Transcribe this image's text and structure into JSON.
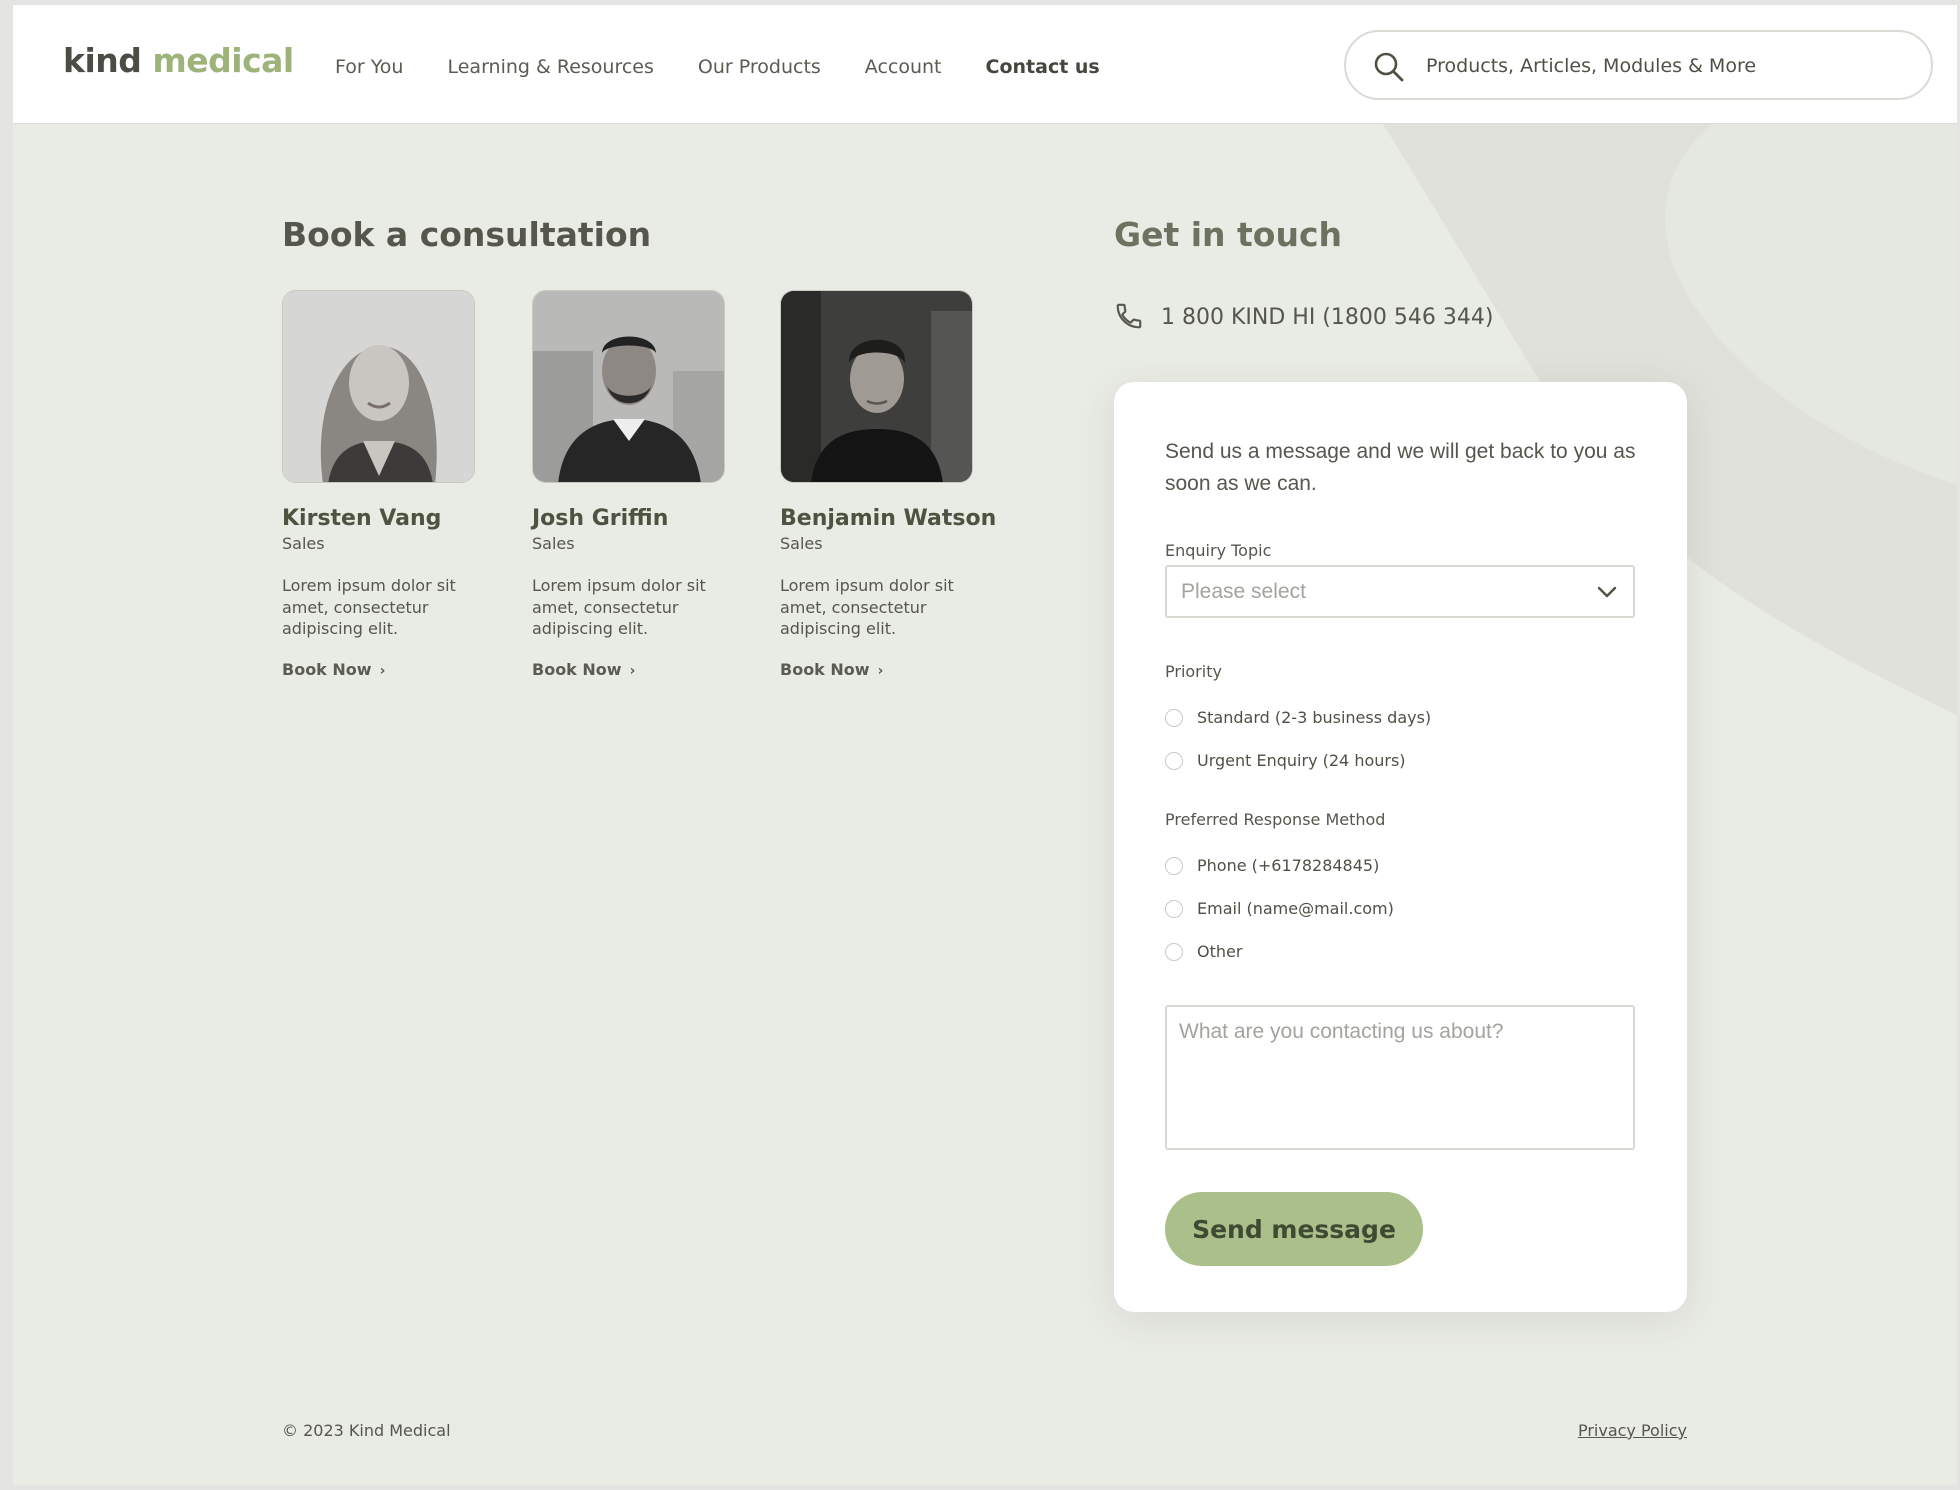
{
  "header": {
    "logo": {
      "part1": "kind",
      "part2": "medical"
    },
    "nav": [
      "For You",
      "Learning & Resources",
      "Our Products",
      "Account",
      "Contact us"
    ],
    "active_nav": "Contact us",
    "search": {
      "placeholder": "Products, Articles, Modules & More",
      "icon": "search-icon"
    }
  },
  "consultation": {
    "title": "Book a consultation",
    "people": [
      {
        "name": "Kirsten Vang",
        "role": "Sales",
        "description": "Lorem ipsum dolor sit amet, consectetur adipiscing elit.",
        "link": "Book Now"
      },
      {
        "name": "Josh Griffin",
        "role": "Sales",
        "description": "Lorem ipsum dolor sit amet, consectetur adipiscing elit.",
        "link": "Book Now"
      },
      {
        "name": "Benjamin Watson",
        "role": "Sales",
        "description": "Lorem ipsum dolor sit amet, consectetur adipiscing elit.",
        "link": "Book Now"
      }
    ]
  },
  "contact": {
    "title": "Get in touch",
    "phone": "1 800 KIND HI  (1800 546 344)",
    "phone_icon": "phone-icon"
  },
  "form": {
    "intro": "Send us a message and we will get back to you as soon as we can.",
    "enquiry_label": "Enquiry Topic",
    "enquiry_placeholder": "Please select",
    "priority_label": "Priority",
    "priority_options": [
      "Standard (2-3 business days)",
      "Urgent Enquiry (24 hours)"
    ],
    "response_label": "Preferred Response Method",
    "response_options": [
      "Phone (+6178284845)",
      "Email (name@mail.com)",
      "Other"
    ],
    "message_placeholder": "What are you contacting us about?",
    "submit": "Send message"
  },
  "footer": {
    "copyright": "© 2023 Kind Medical",
    "privacy": "Privacy Policy"
  },
  "colors": {
    "page_bg": "#e9ebe5",
    "accent": "#9db37a",
    "button": "#aabf8a",
    "text": "#4f5145"
  }
}
